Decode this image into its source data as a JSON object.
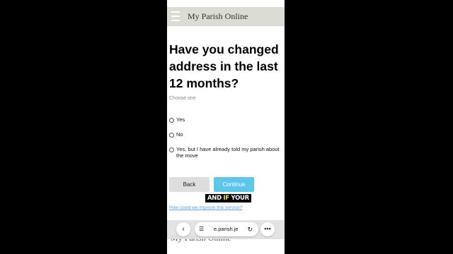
{
  "header": {
    "site_title": "My Parish Online"
  },
  "form": {
    "question": "Have you changed address in the last 12 months?",
    "hint": "Choose one",
    "options": [
      {
        "label": "Yes"
      },
      {
        "label": "No"
      },
      {
        "label": "Yes, but I have already told my parish about the move"
      }
    ],
    "back_label": "Back",
    "continue_label": "Continue",
    "feedback_link": "How could we improve this service?"
  },
  "caption": {
    "part1": "AND ",
    "highlight": "IF",
    "part2": " YOUR"
  },
  "browser": {
    "url": "e.parish.je",
    "icons": [
      "back-arrow-icon",
      "page-menu-icon",
      "reload-icon",
      "more-icon"
    ]
  },
  "footer": {
    "site_title": "My Parish Online"
  }
}
